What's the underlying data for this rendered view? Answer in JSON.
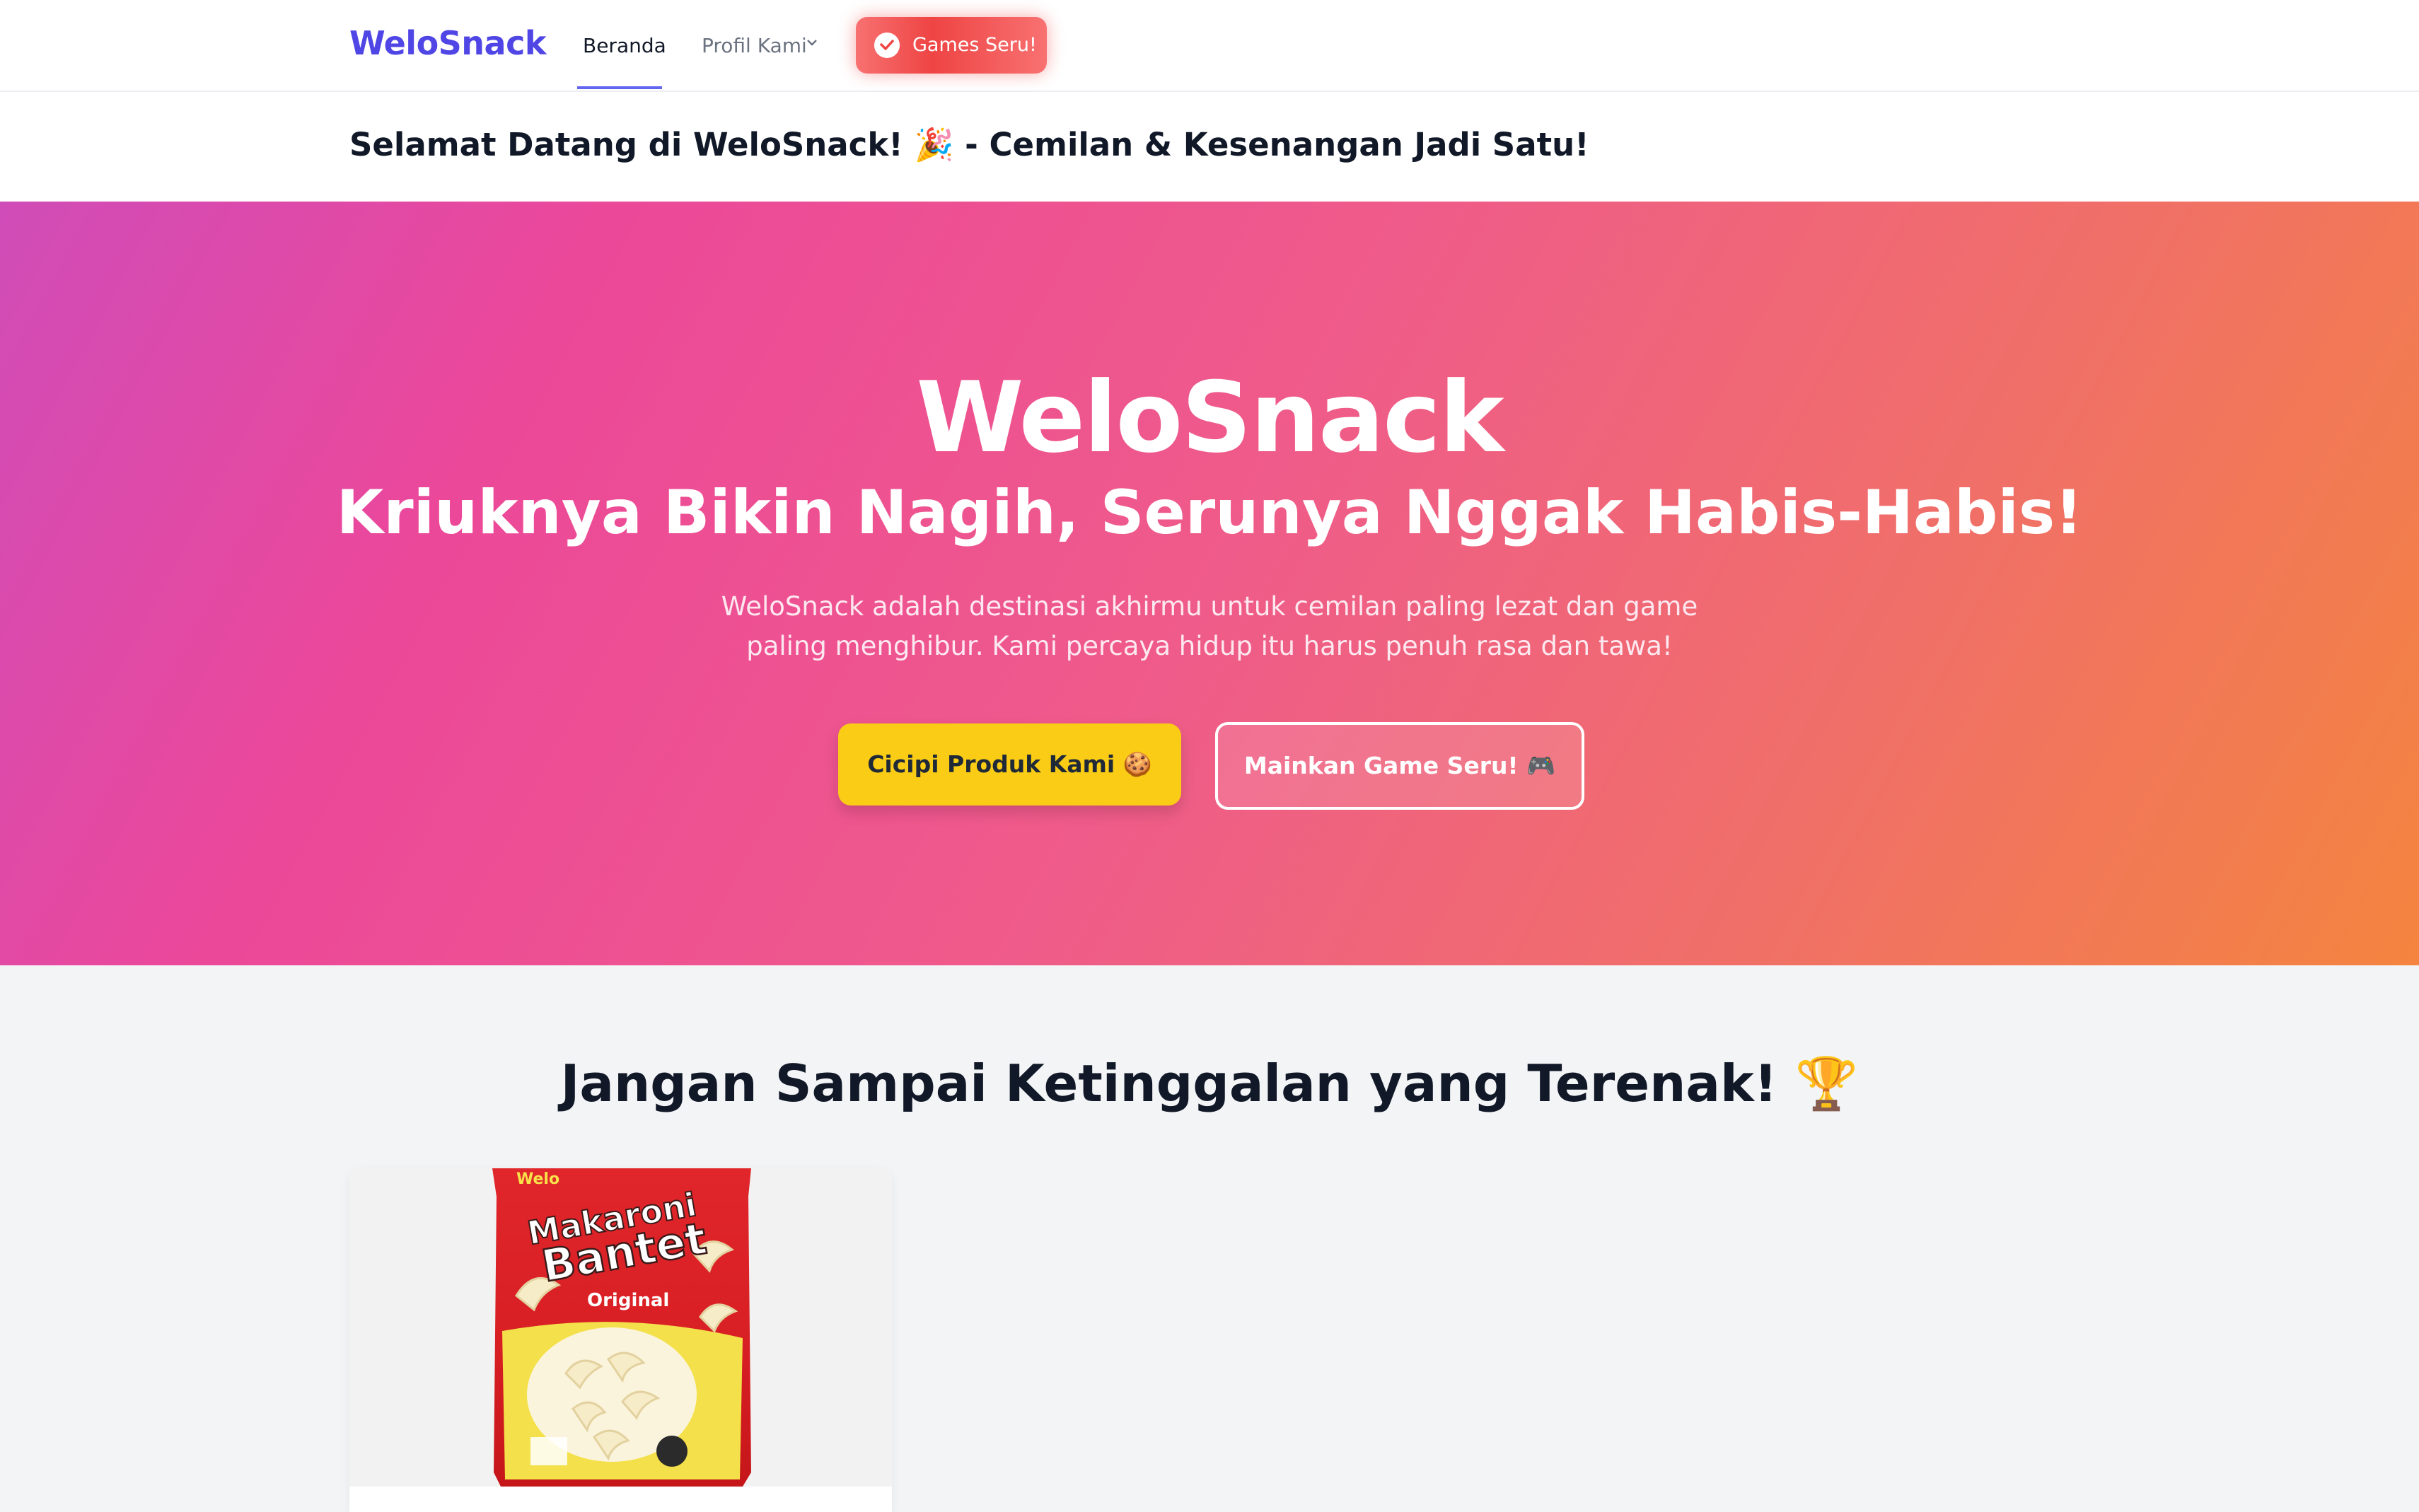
{
  "nav": {
    "brand": "WeloSnack",
    "home": "Beranda",
    "profile": "Profil Kami",
    "games": "Games Seru!"
  },
  "welcome": {
    "text": "Selamat Datang di WeloSnack! 🎉 - Cemilan & Kesenangan Jadi Satu!"
  },
  "hero": {
    "title": "WeloSnack",
    "subtitle": "Kriuknya Bikin Nagih, Serunya Nggak Habis-Habis!",
    "description": "WeloSnack adalah destinasi akhirmu untuk cemilan paling lezat dan game paling menghibur. Kami percaya hidup itu harus penuh rasa dan tawa!",
    "cta_primary": "Cicipi Produk Kami 🍪",
    "cta_secondary": "Mainkan Game Seru! 🎮"
  },
  "section": {
    "title": "Jangan Sampai Ketinggalan yang Terenak! 🏆"
  },
  "product": {
    "brand_mark": "Welo",
    "name_top": "Makaroni",
    "name_bottom": "Bantet",
    "flavor": "Original"
  },
  "colors": {
    "brand": "#4f46e5",
    "accent_yellow": "#facc15",
    "games_red": "#ef4444",
    "hero_start": "#d04cb8",
    "hero_end": "#f4843f"
  }
}
